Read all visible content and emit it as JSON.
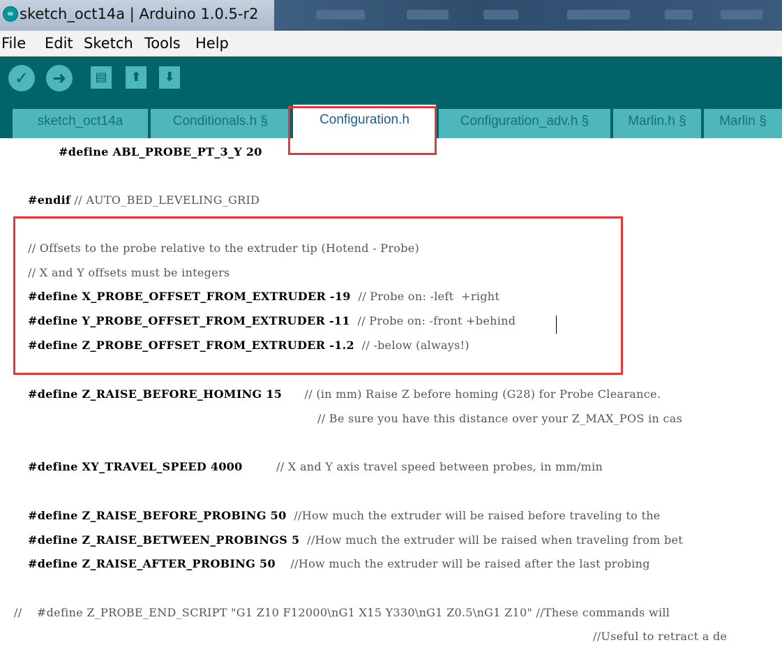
{
  "window": {
    "title": "sketch_oct14a | Arduino 1.0.5-r2",
    "icon": "arduino-logo-icon",
    "icon_glyph": "∞"
  },
  "menu": [
    "File",
    "Edit",
    "Sketch",
    "Tools",
    "Help"
  ],
  "toolbar": {
    "buttons": [
      {
        "name": "verify-button",
        "icon": "checkmark-icon",
        "glyph": "✓"
      },
      {
        "name": "upload-button",
        "icon": "arrow-right-icon",
        "glyph": "➜"
      },
      {
        "name": "new-button",
        "icon": "document-icon",
        "glyph": "▤"
      },
      {
        "name": "open-button",
        "icon": "arrow-up-icon",
        "glyph": "⬆"
      },
      {
        "name": "save-button",
        "icon": "arrow-down-icon",
        "glyph": "⬇"
      }
    ]
  },
  "tabs": [
    "sketch_oct14a",
    "Conditionals.h §",
    "Configuration.h",
    "Configuration_adv.h §",
    "Marlin.h §",
    "Marlin §"
  ],
  "active_tab": "Configuration.h",
  "code_lines": [
    {
      "kw": "#define ABL_PROBE_PT_3_Y 20",
      "cm": ""
    },
    {
      "kw": "#endif",
      "cm": " // AUTO_BED_LEVELING_GRID"
    },
    {
      "kw": "",
      "cm": "// Offsets to the probe relative to the extruder tip (Hotend - Probe)"
    },
    {
      "kw": "",
      "cm": "// X and Y offsets must be integers"
    },
    {
      "kw": "#define X_PROBE_OFFSET_FROM_EXTRUDER -19",
      "cm": "  // Probe on: -left  +right"
    },
    {
      "kw": "#define Y_PROBE_OFFSET_FROM_EXTRUDER -11",
      "cm": "  // Probe on: -front +behind"
    },
    {
      "kw": "#define Z_PROBE_OFFSET_FROM_EXTRUDER -1.2",
      "cm": "  // -below (always!)"
    },
    {
      "kw": "#define Z_RAISE_BEFORE_HOMING 15",
      "cm": "      // (in mm) Raise Z before homing (G28) for Probe Clearance."
    },
    {
      "kw": "",
      "cm": "// Be sure you have this distance over your Z_MAX_POS in cas"
    },
    {
      "kw": "#define XY_TRAVEL_SPEED 4000",
      "cm": "         // X and Y axis travel speed between probes, in mm/min"
    },
    {
      "kw": "#define Z_RAISE_BEFORE_PROBING 50",
      "cm": "  //How much the extruder will be raised before traveling to the"
    },
    {
      "kw": "#define Z_RAISE_BETWEEN_PROBINGS 5",
      "cm": "  //How much the extruder will be raised when traveling from bet"
    },
    {
      "kw": "#define Z_RAISE_AFTER_PROBING 50",
      "cm": "    //How much the extruder will be raised after the last probing"
    },
    {
      "kw": "",
      "cm": "//    #define Z_PROBE_END_SCRIPT \"G1 Z10 F12000\\nG1 X15 Y330\\nG1 Z0.5\\nG1 Z10\" //These commands will"
    },
    {
      "kw": "",
      "cm": "//Useful to retract a de"
    }
  ]
}
